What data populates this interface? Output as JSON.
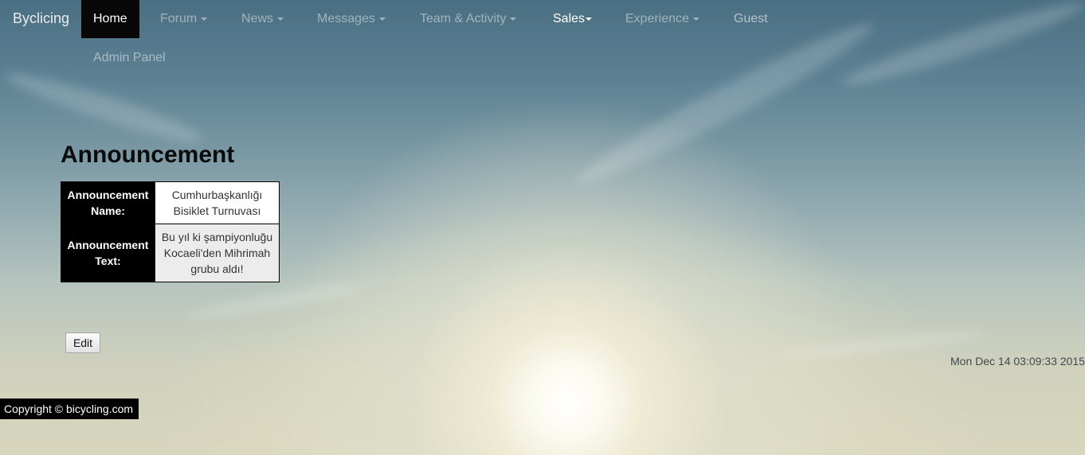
{
  "navbar": {
    "brand": "Byclicing",
    "items": [
      {
        "label": "Home"
      },
      {
        "label": "Forum"
      },
      {
        "label": "News"
      },
      {
        "label": "Messages"
      },
      {
        "label": "Team & Activity"
      },
      {
        "label": "Sales"
      },
      {
        "label": "Experience"
      },
      {
        "label": "Guest"
      }
    ],
    "admin_panel": "Admin Panel"
  },
  "main": {
    "title": "Announcement",
    "table": {
      "rows": [
        {
          "header": "Announcement Name:",
          "value": "Cumhurbaşkanlığı Bisiklet Turnuvası"
        },
        {
          "header": "Announcement Text:",
          "value": "Bu yıl ki şampiyonluğu Kocaeli'den Mihrimah grubu aldı!"
        }
      ]
    },
    "edit_label": "Edit"
  },
  "datetime": "Mon Dec 14 03:09:33 2015",
  "footer": {
    "copyright": "Copyright © bicycling.com"
  }
}
